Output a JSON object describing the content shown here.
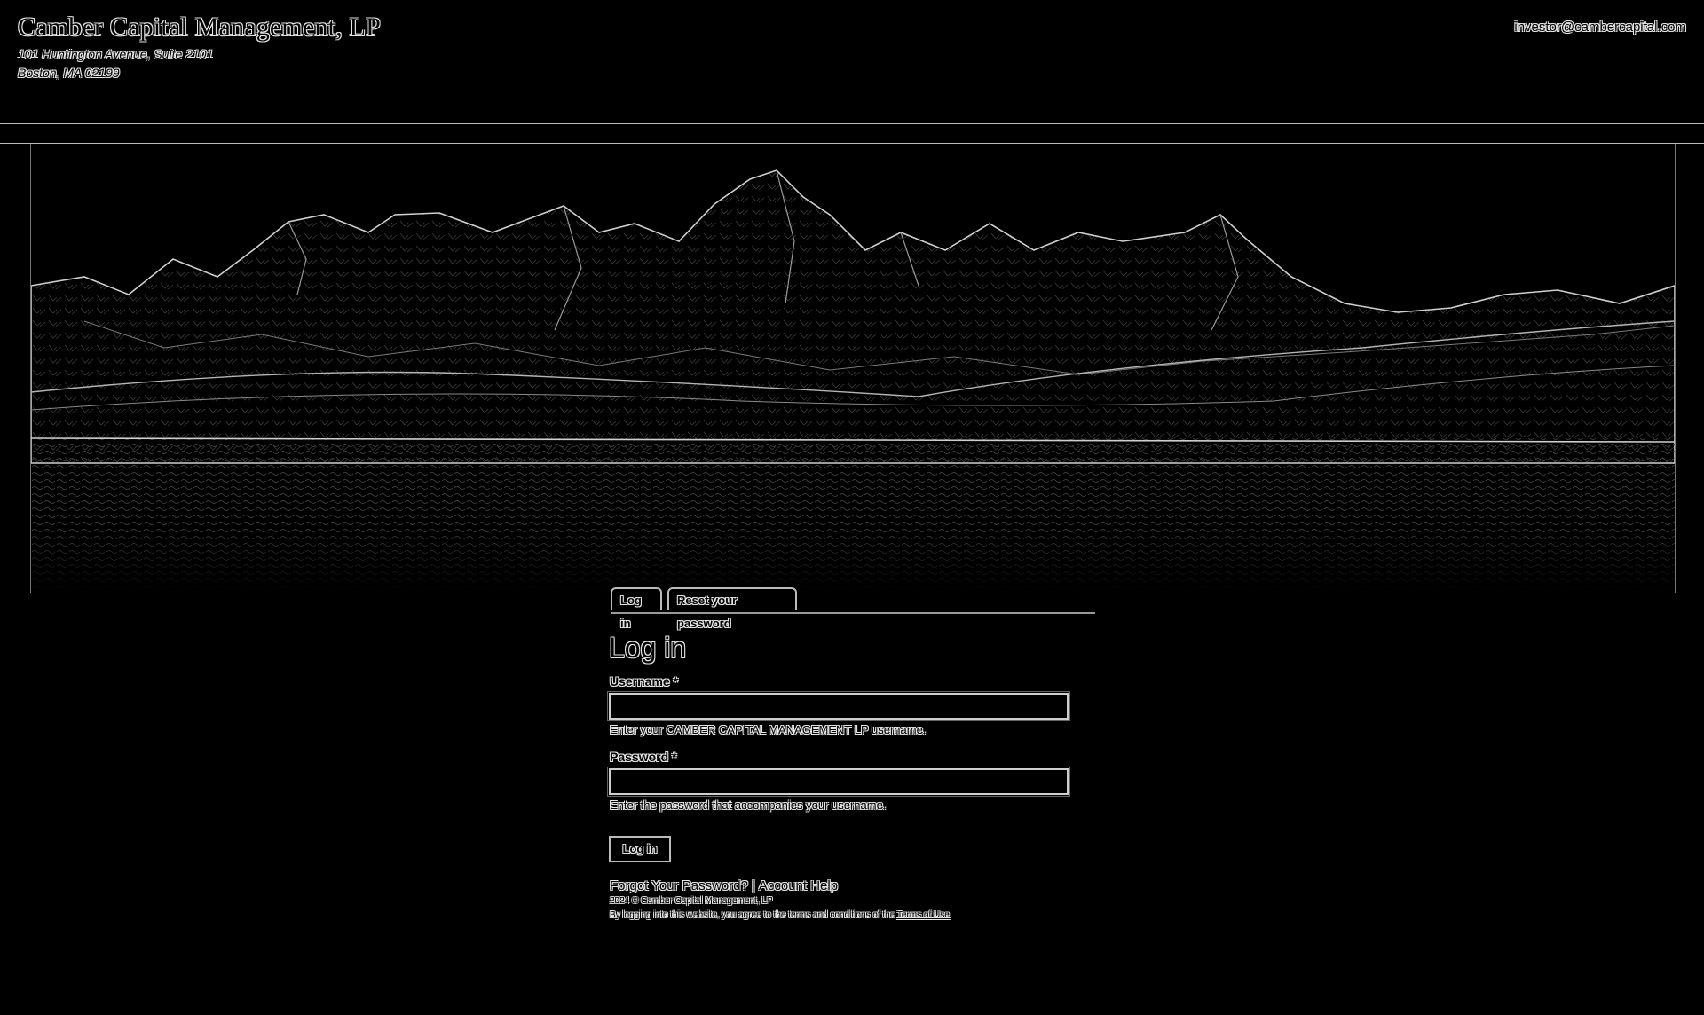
{
  "header": {
    "company": "Camber Capital Management, LP",
    "address_line1": "101 Huntington Avenue, Suite 2101",
    "address_line2": "Boston, MA 02199",
    "email": "investor@cambercapital.com"
  },
  "tabs": [
    {
      "label": "Log in",
      "active": true
    },
    {
      "label": "Reset your password",
      "active": false
    }
  ],
  "form": {
    "title": "Log in",
    "username_label": "Username",
    "username_desc": "Enter your CAMBER CAPITAL MANAGEMENT LP username.",
    "username_value": "",
    "password_label": "Password",
    "password_desc": "Enter the password that accompanies your username.",
    "password_value": "",
    "required_marker": "*",
    "submit_label": "Log in"
  },
  "footer": {
    "forgot_label": "Forgot Your Password?",
    "separator": "|",
    "help_label": "Account Help",
    "copyright": "2024 © Camber Capital Management, LP",
    "terms_prefix": "By logging into this website, you agree to the terms and conditions of the",
    "terms_link": "Terms of Use"
  }
}
